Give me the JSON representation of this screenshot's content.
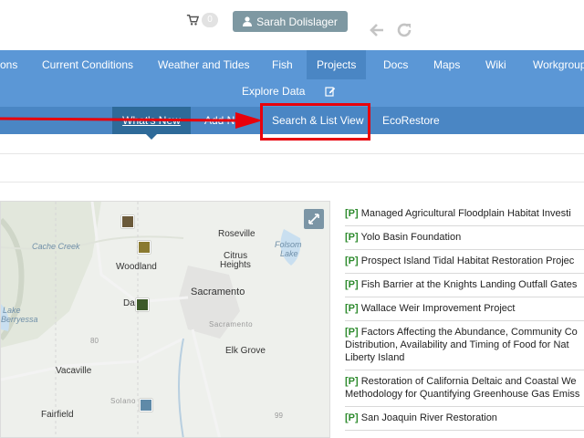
{
  "header": {
    "cart_count": "0",
    "user_name": "Sarah Dolislager"
  },
  "main_nav": {
    "items": [
      {
        "label": "ons",
        "active": false
      },
      {
        "label": "Current Conditions",
        "active": false
      },
      {
        "label": "Weather and Tides",
        "active": false
      },
      {
        "label": "Fish",
        "active": false
      },
      {
        "label": "Projects",
        "active": true
      },
      {
        "label": "Docs",
        "active": false
      },
      {
        "label": "Maps",
        "active": false
      },
      {
        "label": "Wiki",
        "active": false
      },
      {
        "label": "Workgroup",
        "active": false
      }
    ],
    "explore_label": "Explore Data"
  },
  "sub_nav": {
    "items": [
      {
        "label": "What's New"
      },
      {
        "label": "Add N"
      },
      {
        "label": "Search & List View"
      },
      {
        "label": "EcoRestore"
      }
    ]
  },
  "map": {
    "labels": [
      {
        "text": "Roseville",
        "kind": "city"
      },
      {
        "text": "Cache Creek",
        "kind": "water"
      },
      {
        "text": "Folsom",
        "kind": "water"
      },
      {
        "text": "Lake",
        "kind": "water"
      },
      {
        "text": "Citrus",
        "kind": "city"
      },
      {
        "text": "Heights",
        "kind": "city"
      },
      {
        "text": "Woodland",
        "kind": "city"
      },
      {
        "text": "Sacramento",
        "kind": "city"
      },
      {
        "text": "Da",
        "kind": "city"
      },
      {
        "text": "Sacramento",
        "kind": "county"
      },
      {
        "text": "Lake",
        "kind": "water"
      },
      {
        "text": "Berryessa",
        "kind": "water"
      },
      {
        "text": "80",
        "kind": "road"
      },
      {
        "text": "Elk Grove",
        "kind": "city"
      },
      {
        "text": "Vacaville",
        "kind": "city"
      },
      {
        "text": "Solano",
        "kind": "county"
      },
      {
        "text": "Fairfield",
        "kind": "city"
      },
      {
        "text": "99",
        "kind": "road"
      }
    ]
  },
  "projects": [
    {
      "tag": "[P]",
      "lines": [
        "Managed Agricultural Floodplain Habitat Investi"
      ]
    },
    {
      "tag": "[P]",
      "lines": [
        "Yolo Basin Foundation"
      ]
    },
    {
      "tag": "[P]",
      "lines": [
        "Prospect Island Tidal Habitat Restoration Projec"
      ]
    },
    {
      "tag": "[P]",
      "lines": [
        "Fish Barrier at the Knights Landing Outfall Gates"
      ]
    },
    {
      "tag": "[P]",
      "lines": [
        "Wallace Weir Improvement Project"
      ]
    },
    {
      "tag": "[P]",
      "lines": [
        "Factors Affecting the Abundance, Community Co",
        "Distribution, Availability and Timing of Food for Nat",
        "Liberty Island"
      ]
    },
    {
      "tag": "[P]",
      "lines": [
        "Restoration of California Deltaic and Coastal We",
        "Methodology for Quantifying Greenhouse Gas Emiss"
      ]
    },
    {
      "tag": "[P]",
      "lines": [
        "San Joaquin River Restoration"
      ]
    }
  ],
  "colors": {
    "nav_blue": "#5b97d6",
    "subnav_blue": "#4a86c4",
    "active_tab": "#2e6a99",
    "highlight_red": "#e8000b",
    "tag_green": "#2e8b2e"
  },
  "icons": [
    "cart-icon",
    "user-icon",
    "back-arrow-icon",
    "refresh-icon",
    "edit-icon",
    "expand-icon"
  ]
}
